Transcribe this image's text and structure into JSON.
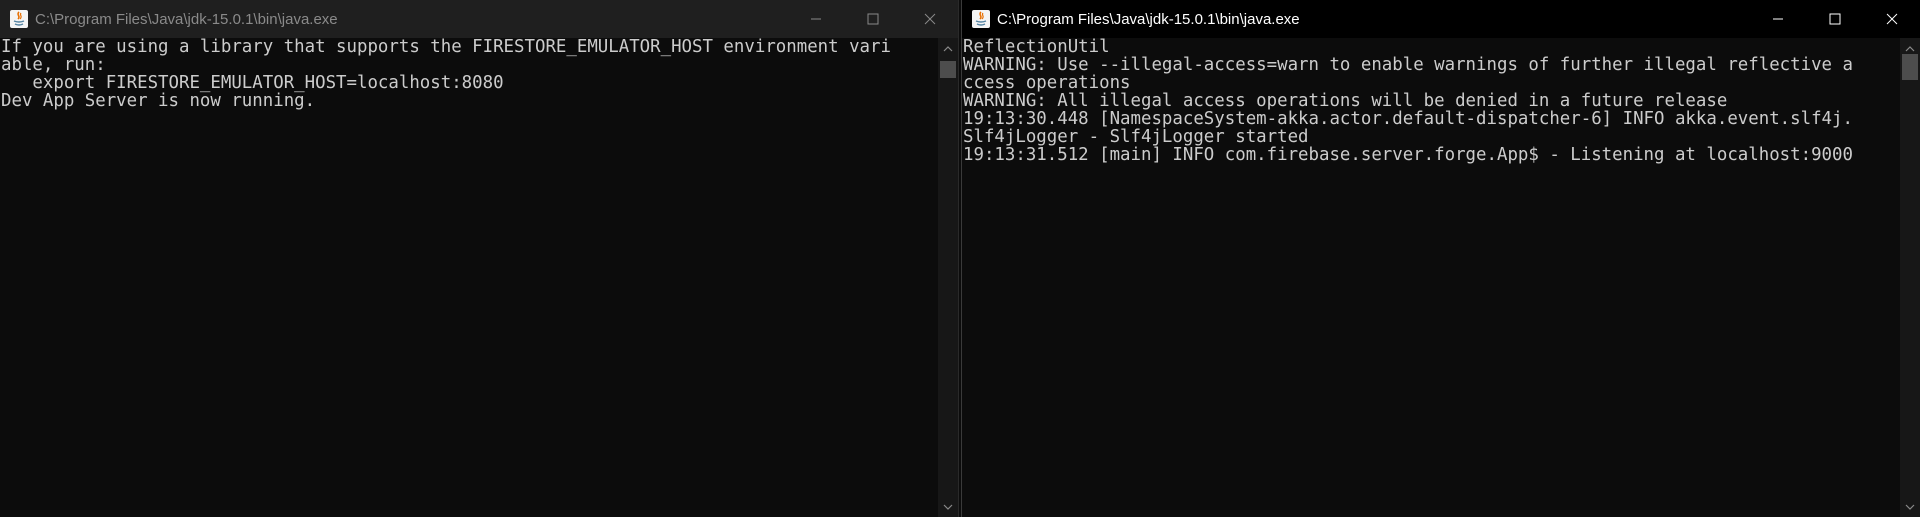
{
  "windows": {
    "left": {
      "title": "C:\\Program Files\\Java\\jdk-15.0.1\\bin\\java.exe",
      "lines": [
        "If you are using a library that supports the FIRESTORE_EMULATOR_HOST environment vari",
        "able, run:",
        "",
        "   export FIRESTORE_EMULATOR_HOST=localhost:8080",
        "",
        "Dev App Server is now running."
      ]
    },
    "right": {
      "title": "C:\\Program Files\\Java\\jdk-15.0.1\\bin\\java.exe",
      "lines": [
        "ReflectionUtil",
        "WARNING: Use --illegal-access=warn to enable warnings of further illegal reflective a",
        "ccess operations",
        "WARNING: All illegal access operations will be denied in a future release",
        "19:13:30.448 [NamespaceSystem-akka.actor.default-dispatcher-6] INFO akka.event.slf4j.",
        "Slf4jLogger - Slf4jLogger started",
        "19:13:31.512 [main] INFO com.firebase.server.forge.App$ - Listening at localhost:9000"
      ]
    }
  },
  "icons": {
    "app": "java-icon",
    "minimize": "minimize-icon",
    "maximize": "maximize-icon",
    "close": "close-icon",
    "scroll_up": "scroll-up-arrow-icon",
    "scroll_down": "scroll-down-arrow-icon"
  },
  "colors": {
    "console_bg": "#0c0c0c",
    "console_text": "#cccccc",
    "inactive_titlebar": "#1f1f1f",
    "active_titlebar": "#000000"
  }
}
